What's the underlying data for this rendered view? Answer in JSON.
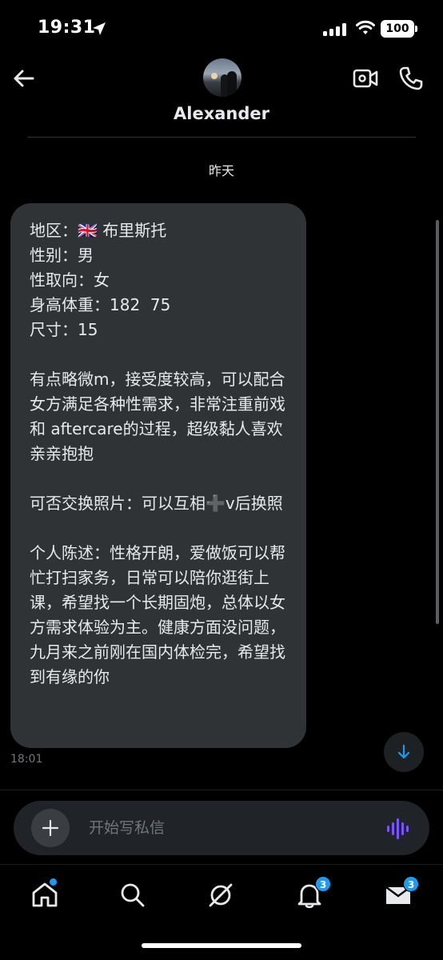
{
  "status_bar": {
    "time": "19:31",
    "battery": "100",
    "icons": [
      "location-arrow-icon",
      "signal-icon",
      "wifi-icon",
      "battery-icon"
    ]
  },
  "header": {
    "contact_name": "Alexander",
    "icons": [
      "back-arrow-icon",
      "video-call-icon",
      "phone-icon"
    ]
  },
  "conversation": {
    "date_separator": "昨天",
    "messages": [
      {
        "text": "地区：🇬🇧 布里斯托\n性别：男\n性取向：女\n身高体重：182  75\n尺寸：15\n\n有点略微m，接受度较高，可以配合女方满足各种性需求，非常注重前戏和 aftercare的过程，超级黏人喜欢亲亲抱抱\n\n可否交换照片：可以互相➕v后换照\n\n个人陈述：性格开朗，爱做饭可以帮忙打扫家务，日常可以陪你逛街上课，希望找一个长期固炮，总体以女方需求体验为主。健康方面没问题，九月来之前刚在国内体检完，希望找到有缘的你",
        "time": "18:01"
      }
    ]
  },
  "composer": {
    "placeholder": "开始写私信"
  },
  "tab_bar": {
    "tabs": [
      {
        "name": "home",
        "icon": "home-icon",
        "badge": ""
      },
      {
        "name": "search",
        "icon": "search-icon",
        "badge": ""
      },
      {
        "name": "grok",
        "icon": "grok-icon",
        "badge": ""
      },
      {
        "name": "notifications",
        "icon": "bell-icon",
        "badge": "3"
      },
      {
        "name": "messages",
        "icon": "mail-icon",
        "badge": "3"
      }
    ]
  },
  "colors": {
    "background": "#000000",
    "bubble": "#2f3336",
    "accent": "#1d9bf0",
    "muted_text": "#71767b",
    "voice_icon": "#7856ff"
  }
}
